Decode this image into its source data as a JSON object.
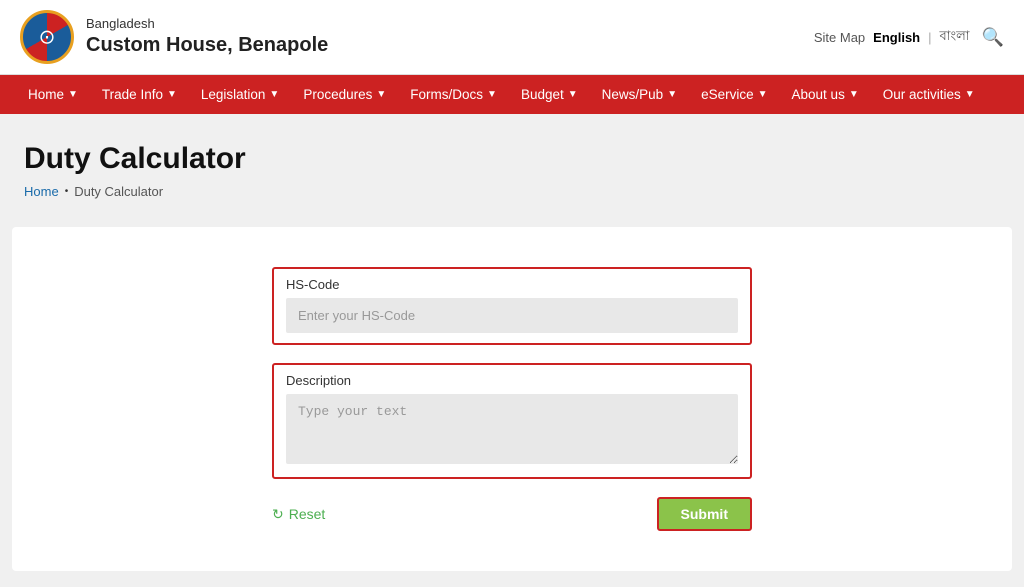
{
  "header": {
    "org_line1": "Bangladesh",
    "org_line2": "Custom House, Benapole",
    "sitemap_label": "Site Map",
    "lang_en": "English",
    "lang_bn": "বাংলা"
  },
  "navbar": {
    "items": [
      {
        "label": "Home",
        "has_chevron": true
      },
      {
        "label": "Trade Info",
        "has_chevron": true
      },
      {
        "label": "Legislation",
        "has_chevron": true
      },
      {
        "label": "Procedures",
        "has_chevron": true
      },
      {
        "label": "Forms/Docs",
        "has_chevron": true
      },
      {
        "label": "Budget",
        "has_chevron": true
      },
      {
        "label": "News/Pub",
        "has_chevron": true
      },
      {
        "label": "eService",
        "has_chevron": true
      },
      {
        "label": "About us",
        "has_chevron": true
      },
      {
        "label": "Our activities",
        "has_chevron": true
      }
    ]
  },
  "page": {
    "title": "Duty Calculator",
    "breadcrumb_home": "Home",
    "breadcrumb_current": "Duty Calculator"
  },
  "form": {
    "hs_code_label": "HS-Code",
    "hs_code_placeholder": "Enter your HS-Code",
    "description_label": "Description",
    "description_placeholder": "Type your text",
    "reset_label": "Reset",
    "submit_label": "Submit"
  }
}
